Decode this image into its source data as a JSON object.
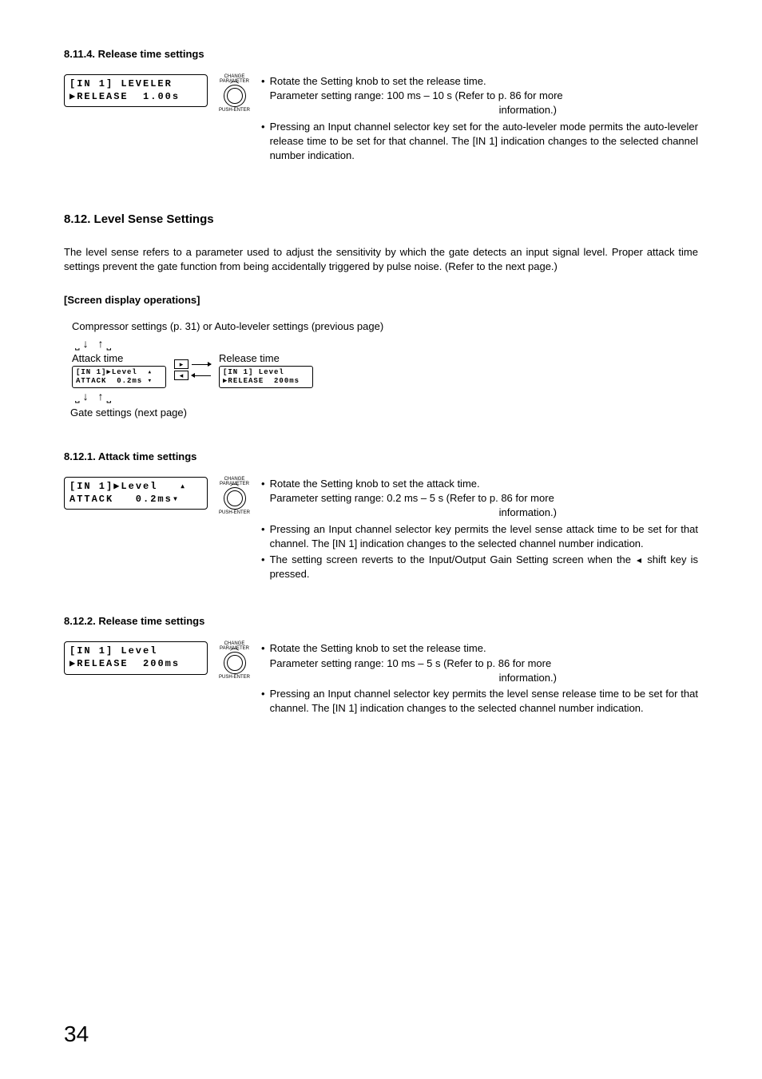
{
  "s1": {
    "heading": "8.11.4. Release time settings",
    "lcd_line1": "[IN 1] LEVELER",
    "lcd_line2": "▶RELEASE  1.00s",
    "knob_top": "CHANGE",
    "knob_top2": "PARAMETER",
    "knob_bottom": "PUSH-ENTER",
    "b1": "Rotate the Setting knob to set the release time.",
    "b1a": "Parameter setting range: 100 ms – 10 s (Refer to p. 86 for more",
    "b1b": "information.)",
    "b2": "Pressing an Input channel selector key set for the auto-leveler mode permits the auto-leveler release time to be set for that channel. The [IN 1] indication changes to the selected channel number indication."
  },
  "s2": {
    "heading": "8.12. Level Sense Settings",
    "para": "The level sense refers to a parameter used to adjust the sensitivity by which the gate detects an input signal level. Proper attack time settings prevent the gate function from being accidentally triggered by pulse noise. (Refer to the next page.)",
    "ops": "[Screen display operations]",
    "flow_top": "Compressor settings (p. 31) or Auto-leveler settings (previous page)",
    "attack_label": "Attack time",
    "release_label": "Release time",
    "lcd_a1": "[IN 1]▶Level  ▴",
    "lcd_a2": "ATTACK  0.2ms ▾",
    "lcd_b1": "[IN 1] Level",
    "lcd_b2": "▶RELEASE  200ms",
    "gate_label": "Gate settings (next page)"
  },
  "s3": {
    "heading": "8.12.1. Attack time settings",
    "lcd_line1": "[IN 1]▶Level   ▴",
    "lcd_line2": "ATTACK   0.2ms▾",
    "knob_top": "CHANGE",
    "knob_top2": "PARAMETER",
    "knob_bottom": "PUSH-ENTER",
    "b1": "Rotate the Setting knob to set the attack time.",
    "b1a": "Parameter setting range: 0.2 ms – 5 s (Refer to p. 86 for more",
    "b1b": "information.)",
    "b2": "Pressing an Input channel selector key permits the level sense attack time to be set for that channel. The [IN 1] indication changes to the selected channel number indication.",
    "b3a": "The setting screen reverts to the Input/Output Gain Setting screen when the ",
    "b3b": " shift key is pressed."
  },
  "s4": {
    "heading": "8.12.2. Release time settings",
    "lcd_line1": "[IN 1] Level",
    "lcd_line2": "▶RELEASE  200ms",
    "knob_top": "CHANGE",
    "knob_top2": "PARAMETER",
    "knob_bottom": "PUSH-ENTER",
    "b1": "Rotate the Setting knob to set the release time.",
    "b1a": "Parameter setting range: 10 ms – 5 s (Refer to p. 86 for more",
    "b1b": "information.)",
    "b2": "Pressing an Input channel selector key permits the level sense release time to be set for that channel. The [IN 1] indication changes to the selected channel number indication."
  },
  "page": "34"
}
